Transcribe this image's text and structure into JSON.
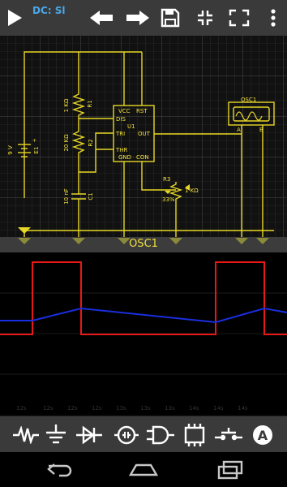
{
  "toolbar": {
    "title": "DC: Sl",
    "icons": [
      "play-icon",
      "undo-icon",
      "redo-icon",
      "save-icon",
      "collapse-icon",
      "expand-icon",
      "overflow-menu-icon"
    ]
  },
  "schematic": {
    "components": {
      "r1": {
        "name": "R1",
        "value": "1 KΩ"
      },
      "r2": {
        "name": "R2",
        "value": "20 KΩ"
      },
      "c1": {
        "name": "C1",
        "value": "10 nF"
      },
      "e1": {
        "name": "E1",
        "value": "9 V"
      },
      "r3": {
        "name": "R3",
        "value": "1 KΩ",
        "percent": "33%"
      },
      "u1": {
        "name": "U1",
        "pins": {
          "vcc": "VCC",
          "rst": "RST",
          "dis": "DIS",
          "tri": "TRI",
          "out": "OUT",
          "thr": "THR",
          "gnd": "GND",
          "con": "CON"
        }
      },
      "osc1": {
        "name": "OSC1",
        "pin_a": "A",
        "pin_b": "B"
      }
    },
    "colors": {
      "wire": "#e8d826",
      "component": "#f0e03c"
    }
  },
  "oscilloscope": {
    "label": "OSC1",
    "time_labels": [
      "12s",
      "12s",
      "12s",
      "12s",
      "13s",
      "13s",
      "13s",
      "14s",
      "14s",
      "14s"
    ],
    "colors": {
      "channel_a": "#e81818",
      "channel_b": "#1a2ee0"
    },
    "channel_a_levels": {
      "high": 1.0,
      "low": 0.0
    },
    "channel_b_levels": {
      "min": 0.33,
      "max": 0.67
    }
  },
  "parts_bar": {
    "icons": [
      "resistor-icon",
      "ground-icon",
      "diode-icon",
      "lamp-icon",
      "logic-gate-icon",
      "ic-chip-icon",
      "switch-icon",
      "ammeter-icon"
    ]
  },
  "navbar": {
    "icons": [
      "back-icon",
      "home-icon",
      "recent-apps-icon"
    ]
  }
}
